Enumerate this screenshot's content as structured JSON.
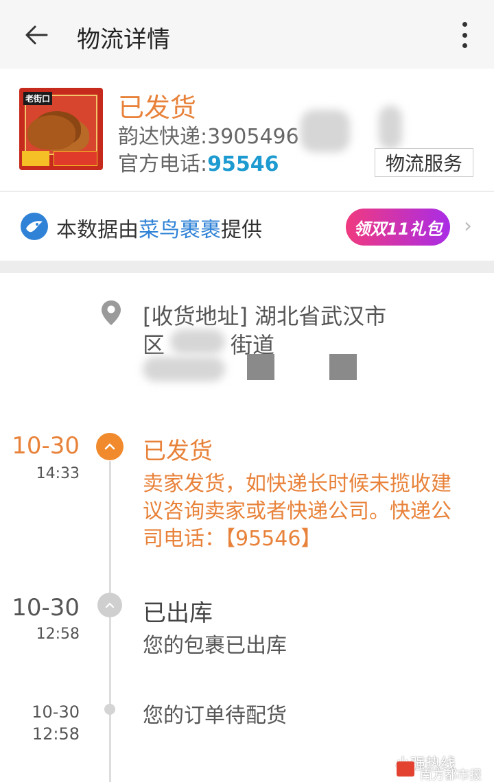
{
  "header": {
    "title": "物流详情"
  },
  "package": {
    "status": "已发货",
    "courier_label": "韵达快递:",
    "tracking_visible": "3905496",
    "phone_label": "官方电话:",
    "phone_number": "95546",
    "service_button": "物流服务"
  },
  "cainiao": {
    "prefix": "本数据由",
    "brand": "菜鸟裹裹",
    "suffix": "提供",
    "gift_button": "领双11礼包"
  },
  "address": {
    "line1": "[收货地址] 湖北省武汉市",
    "line2_a": "区",
    "line2_b": "街道"
  },
  "timeline": [
    {
      "date": "10-30",
      "time": "14:33",
      "title": "已发货",
      "desc": "卖家发货，如快递长时候未揽收建议咨询卖家或者快递公司。快递公司电话：【95546】"
    },
    {
      "date": "10-30",
      "time": "12:58",
      "title": "已出库",
      "desc": "您的包裹已出库"
    },
    {
      "date": "10-30",
      "time": "12:58",
      "title": "",
      "desc": "您的订单待配货"
    }
  ],
  "watermark": {
    "account": "小强热线",
    "source": "南方都市报"
  },
  "colors": {
    "accent_orange": "#e8823a",
    "link_blue": "#1d9bd1",
    "brand_blue": "#2f82d6",
    "gift_gradient_start": "#f03a7f",
    "gift_gradient_end": "#a92ce6"
  }
}
